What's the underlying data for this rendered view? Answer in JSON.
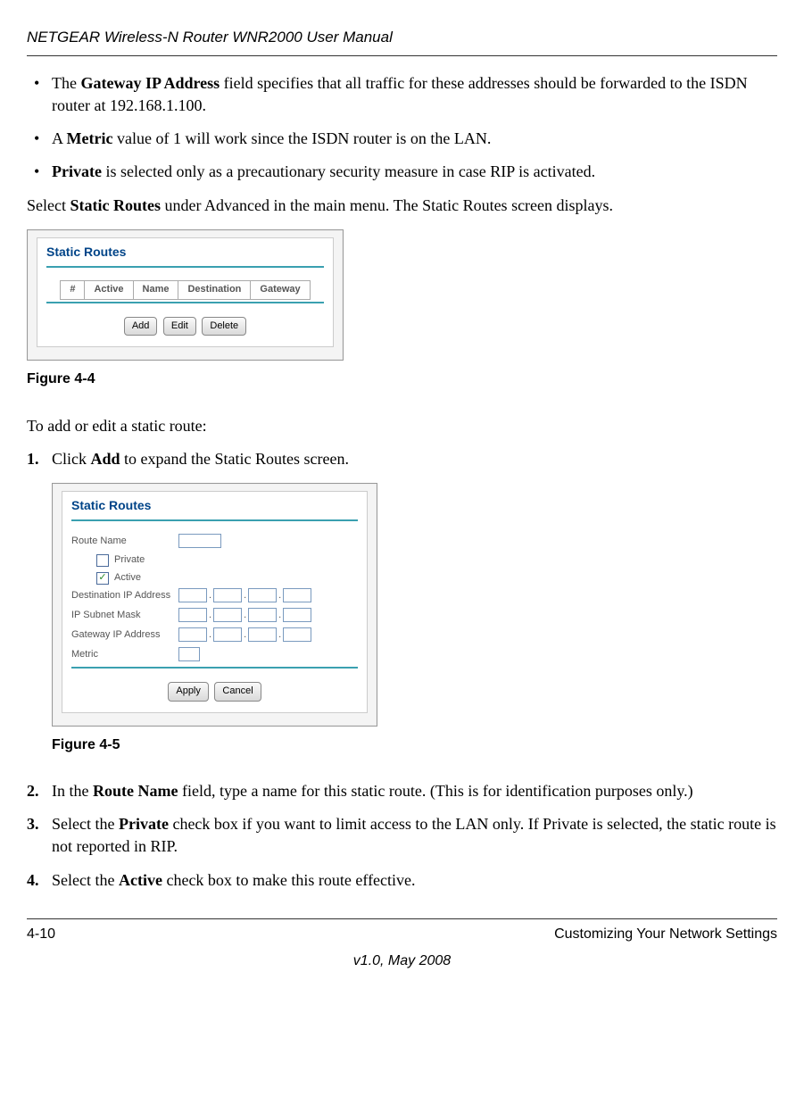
{
  "header": {
    "doc_title": "NETGEAR Wireless-N Router WNR2000 User Manual"
  },
  "bullets": [
    {
      "pre": "The ",
      "bold": "Gateway IP Address",
      "post": " field specifies that all traffic for these addresses should be forwarded to the ISDN router at 192.168.1.100."
    },
    {
      "pre": "A ",
      "bold": "Metric",
      "post": " value of 1 will work since the ISDN router is on the LAN."
    },
    {
      "pre": "",
      "bold": "Private",
      "post": " is selected only as a precautionary security measure in case RIP is activated."
    }
  ],
  "select_para": {
    "pre": "Select ",
    "bold": "Static Routes",
    "post": " under Advanced in the main menu. The Static Routes screen displays."
  },
  "fig44": {
    "panel_title": "Static Routes",
    "cols": [
      "#",
      "Active",
      "Name",
      "Destination",
      "Gateway"
    ],
    "btn_add": "Add",
    "btn_edit": "Edit",
    "btn_delete": "Delete",
    "caption": "Figure 4-4"
  },
  "add_intro": "To add or edit a static route:",
  "step1": {
    "num": "1.",
    "pre": "Click ",
    "bold": "Add",
    "post": " to expand the Static Routes screen."
  },
  "fig45": {
    "panel_title": "Static Routes",
    "route_name_label": "Route Name",
    "private_label": "Private",
    "active_label": "Active",
    "active_checked": true,
    "private_checked": false,
    "dest_label": "Destination IP Address",
    "mask_label": "IP Subnet Mask",
    "gw_label": "Gateway IP Address",
    "metric_label": "Metric",
    "btn_apply": "Apply",
    "btn_cancel": "Cancel",
    "caption": "Figure 4-5"
  },
  "step2": {
    "num": "2.",
    "pre": "In the ",
    "bold": "Route Name",
    "post": " field, type a name for this static route. (This is for identification purposes only.)"
  },
  "step3": {
    "num": "3.",
    "pre": "Select the ",
    "bold": "Private",
    "post": " check box if you want to limit access to the LAN only. If Private is selected, the static route is not reported in RIP."
  },
  "step4": {
    "num": "4.",
    "pre": "Select the ",
    "bold": "Active",
    "post": " check box to make this route effective."
  },
  "footer": {
    "page": "4-10",
    "section": "Customizing Your Network Settings",
    "version": "v1.0, May 2008"
  }
}
